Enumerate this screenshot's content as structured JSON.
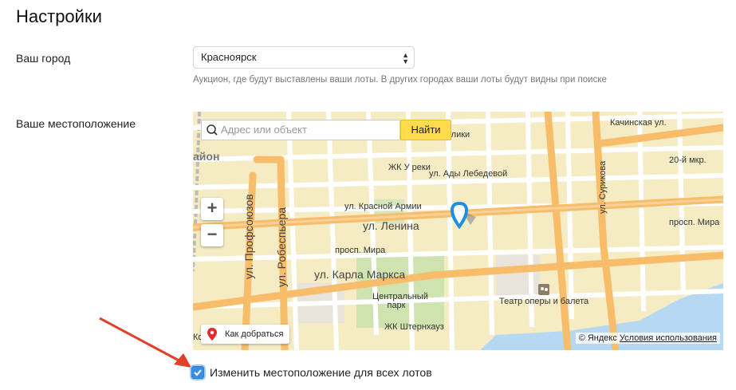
{
  "page": {
    "title": "Настройки"
  },
  "city": {
    "label": "Ваш город",
    "selected": "Красноярск",
    "hint": "Аукцион, где будут выставлены ваши лоты. В других городах ваши лоты будут видны при поиске"
  },
  "location": {
    "label": "Ваше местоположение",
    "map": {
      "search_placeholder": "Адрес или объект",
      "find_button": "Найти",
      "zoom_in": "+",
      "zoom_out": "−",
      "route_button": "Как добраться",
      "copyright": "© Яндекс",
      "terms_link": "Условия использования",
      "street_labels": {
        "lenina": "ул. Ленина",
        "karla_marksa": "ул. Карла Маркса",
        "mira": "просп. Мира",
        "krasnoy_armii": "ул. Красной Армии",
        "respubliki": "ул. Республики",
        "ady_lebedevoy": "ул. Ады Лебедевой",
        "zhk_u_reki": "ЖК У реки",
        "profsoyuzov": "ул. Профсоюзов",
        "robespera": "ул. Робеспьера",
        "surikova": "ул. Сурикова",
        "kachinskaya": "Качинская ул.",
        "mkr_20": "20-й мкр.",
        "prosp_mira_right": "просп. Мира",
        "park": "Центральный парк",
        "teatr": "Театр оперы и балета",
        "zhk_shterhauz": "ЖК Штернхауз",
        "rayon": "айон",
        "kos": "Кос"
      },
      "marker_icon": "location-pin-icon"
    }
  },
  "update_all": {
    "checked": true,
    "label": "Изменить местоположение для всех лотов"
  },
  "colors": {
    "find_button": "#ffdb4d",
    "checkbox": "#3a8ee6",
    "annotation_arrow": "#e0402a",
    "marker": "#1e8fe1"
  }
}
